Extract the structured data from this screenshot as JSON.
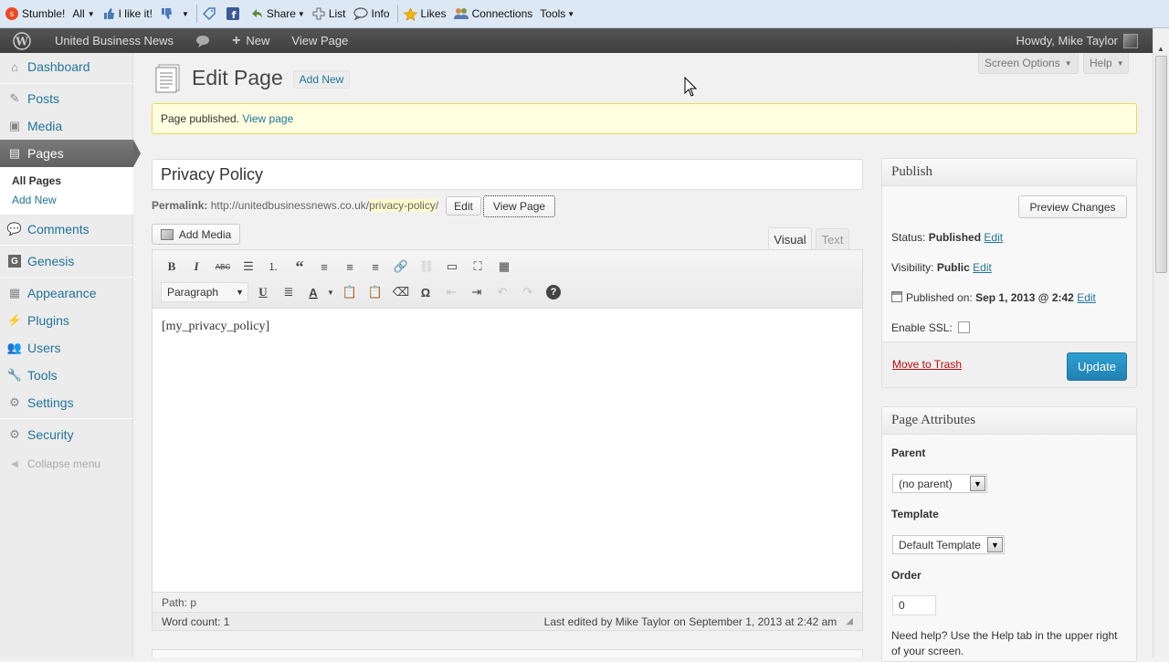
{
  "stumble_toolbar": {
    "stumble": "Stumble!",
    "all": "All",
    "like": "I like it!",
    "share": "Share",
    "list": "List",
    "info": "Info",
    "likes": "Likes",
    "connections": "Connections",
    "tools": "Tools"
  },
  "admin_bar": {
    "site_name": "United Business News",
    "new": "New",
    "view_page": "View Page",
    "howdy": "Howdy, Mike Taylor"
  },
  "sidebar": {
    "items": [
      {
        "label": "Dashboard",
        "icon": "dashboard-icon"
      },
      {
        "label": "Posts",
        "icon": "pin-icon"
      },
      {
        "label": "Media",
        "icon": "media-icon"
      },
      {
        "label": "Pages",
        "icon": "pages-icon"
      },
      {
        "label": "Comments",
        "icon": "comment-icon"
      },
      {
        "label": "Genesis",
        "icon": "genesis-icon"
      },
      {
        "label": "Appearance",
        "icon": "appearance-icon"
      },
      {
        "label": "Plugins",
        "icon": "plugin-icon"
      },
      {
        "label": "Users",
        "icon": "users-icon"
      },
      {
        "label": "Tools",
        "icon": "tools-icon"
      },
      {
        "label": "Settings",
        "icon": "settings-icon"
      },
      {
        "label": "Security",
        "icon": "security-icon"
      }
    ],
    "submenu": {
      "all_pages": "All Pages",
      "add_new": "Add New"
    },
    "collapse": "Collapse menu"
  },
  "header": {
    "title": "Edit Page",
    "add_new": "Add New",
    "screen_options": "Screen Options",
    "help": "Help"
  },
  "notice": {
    "text": "Page published.",
    "link": "View page"
  },
  "post": {
    "title": "Privacy Policy",
    "permalink_label": "Permalink:",
    "permalink_base": "http://unitedbusinessnews.co.uk/",
    "permalink_slug": "privacy-policy",
    "permalink_end": "/",
    "edit_btn": "Edit",
    "view_btn": "View Page"
  },
  "editor": {
    "add_media": "Add Media",
    "tab_visual": "Visual",
    "tab_text": "Text",
    "format": "Paragraph",
    "content": "[my_privacy_policy]",
    "path": "Path: p",
    "word_count": "Word count: 1",
    "last_edited": "Last edited by Mike Taylor on September 1, 2013 at 2:42 am"
  },
  "publish": {
    "heading": "Publish",
    "preview": "Preview Changes",
    "status_label": "Status:",
    "status_value": "Published",
    "visibility_label": "Visibility:",
    "visibility_value": "Public",
    "published_label": "Published on:",
    "published_value": "Sep 1, 2013 @ 2:42",
    "edit": "Edit",
    "ssl_label": "Enable SSL:",
    "trash": "Move to Trash",
    "update": "Update"
  },
  "attributes": {
    "heading": "Page Attributes",
    "parent_label": "Parent",
    "parent_value": "(no parent)",
    "template_label": "Template",
    "template_value": "Default Template",
    "order_label": "Order",
    "order_value": "0",
    "help_text_1": "Need help? Use the Help tab in the upper right",
    "help_text_2": "of your screen."
  },
  "colors": {
    "link": "#21759b",
    "update_button": "#2e8cc5",
    "trash": "#bc0b0b",
    "notice": "#ffffe0"
  }
}
